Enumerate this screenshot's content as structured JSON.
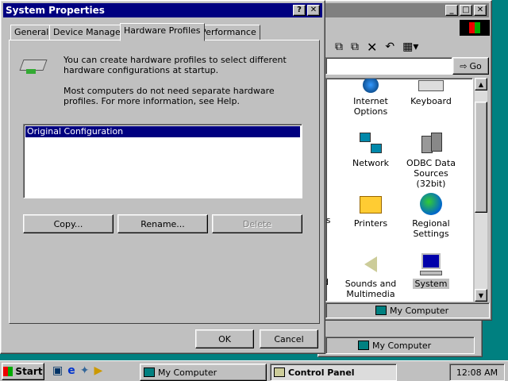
{
  "control_panel": {
    "window_title": "Control Panel",
    "go_label": "Go",
    "icons": [
      {
        "name": "Internet Options"
      },
      {
        "name": "Keyboard"
      },
      {
        "name": "Network"
      },
      {
        "name": "ODBC Data Sources (32bit)"
      },
      {
        "name": "Printers"
      },
      {
        "name": "Regional Settings"
      },
      {
        "name": "Sounds and Multimedia"
      },
      {
        "name": "System"
      }
    ],
    "partial_labels": {
      "row3": "ons",
      "row4": "d"
    },
    "status_text": "My Computer"
  },
  "behind_window": {
    "status_text": "My Computer"
  },
  "dialog": {
    "title": "System Properties",
    "help_btn": "?",
    "close_btn": "✕",
    "tabs": [
      {
        "label": "General"
      },
      {
        "label": "Device Manager"
      },
      {
        "label": "Hardware Profiles"
      },
      {
        "label": "Performance"
      }
    ],
    "active_tab": "Hardware Profiles",
    "intro_text": "You can create hardware profiles to select different hardware configurations at startup.",
    "info_text": "Most computers do not need separate hardware profiles. For more information, see Help.",
    "profiles": [
      "Original Configuration"
    ],
    "buttons": {
      "copy": "Copy...",
      "rename": "Rename...",
      "delete": "Delete",
      "ok": "OK",
      "cancel": "Cancel"
    }
  },
  "taskbar": {
    "start_label": "Start",
    "tasks": [
      {
        "label": "My Computer"
      },
      {
        "label": "Control Panel"
      }
    ],
    "clock": "12:08 AM"
  },
  "colors": {
    "titlebar_active": "#000080",
    "titlebar_inactive": "#808080",
    "desktop": "#008080",
    "face": "#c0c0c0"
  }
}
